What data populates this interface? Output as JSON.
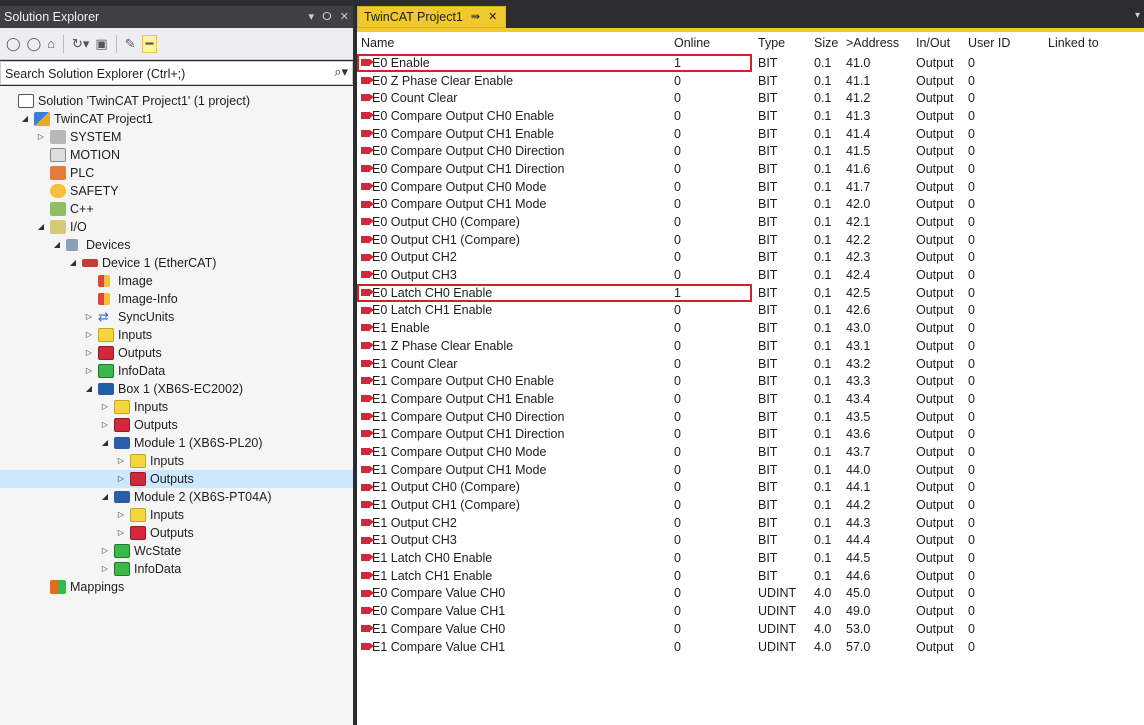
{
  "solution_explorer": {
    "title": "Solution Explorer",
    "title_controls": [
      "▾",
      "ⵔ",
      "✕"
    ],
    "toolbar_icons": [
      "back-icon",
      "forward-icon",
      "home-icon",
      "history-icon",
      "sync-icon",
      "collapse-all-icon",
      "properties-icon",
      "pin-icon"
    ],
    "search_placeholder": "Search Solution Explorer (Ctrl+;)",
    "tree": [
      {
        "label": "Solution 'TwinCAT Project1' (1 project)",
        "icon": "solution-icon",
        "level": 0,
        "expander": ""
      },
      {
        "label": "TwinCAT Project1",
        "icon": "project-icon",
        "level": 1,
        "expander": "◢"
      },
      {
        "label": "SYSTEM",
        "icon": "system-icon",
        "level": 2,
        "expander": "▷"
      },
      {
        "label": "MOTION",
        "icon": "motion-icon",
        "level": 2,
        "expander": ""
      },
      {
        "label": "PLC",
        "icon": "plc-icon",
        "level": 2,
        "expander": ""
      },
      {
        "label": "SAFETY",
        "icon": "safety-icon",
        "level": 2,
        "expander": ""
      },
      {
        "label": "C++",
        "icon": "cpp-icon",
        "level": 2,
        "expander": ""
      },
      {
        "label": "I/O",
        "icon": "io-icon",
        "level": 2,
        "expander": "◢"
      },
      {
        "label": "Devices",
        "icon": "devices-icon",
        "level": 3,
        "expander": "◢"
      },
      {
        "label": "Device 1 (EtherCAT)",
        "icon": "ethercat-device-icon",
        "level": 4,
        "expander": "◢"
      },
      {
        "label": "Image",
        "icon": "image-icon",
        "level": 5,
        "expander": ""
      },
      {
        "label": "Image-Info",
        "icon": "image-info-icon",
        "level": 5,
        "expander": ""
      },
      {
        "label": "SyncUnits",
        "icon": "sync-units-icon",
        "level": 5,
        "expander": "▷"
      },
      {
        "label": "Inputs",
        "icon": "inputs-icon",
        "level": 5,
        "expander": "▷"
      },
      {
        "label": "Outputs",
        "icon": "outputs-icon",
        "level": 5,
        "expander": "▷"
      },
      {
        "label": "InfoData",
        "icon": "infodata-icon",
        "level": 5,
        "expander": "▷"
      },
      {
        "label": "Box 1 (XB6S-EC2002)",
        "icon": "box-icon",
        "level": 5,
        "expander": "◢"
      },
      {
        "label": "Inputs",
        "icon": "inputs-icon",
        "level": 6,
        "expander": "▷"
      },
      {
        "label": "Outputs",
        "icon": "outputs-icon",
        "level": 6,
        "expander": "▷"
      },
      {
        "label": "Module 1 (XB6S-PL20)",
        "icon": "module-icon",
        "level": 6,
        "expander": "◢"
      },
      {
        "label": "Inputs",
        "icon": "inputs-icon",
        "level": 7,
        "expander": "▷"
      },
      {
        "label": "Outputs",
        "icon": "outputs-icon",
        "level": 7,
        "expander": "▷",
        "selected": true
      },
      {
        "label": "Module 2 (XB6S-PT04A)",
        "icon": "module-icon",
        "level": 6,
        "expander": "◢"
      },
      {
        "label": "Inputs",
        "icon": "inputs-icon",
        "level": 7,
        "expander": "▷"
      },
      {
        "label": "Outputs",
        "icon": "outputs-icon",
        "level": 7,
        "expander": "▷"
      },
      {
        "label": "WcState",
        "icon": "wcstate-icon",
        "level": 6,
        "expander": "▷"
      },
      {
        "label": "InfoData",
        "icon": "infodata-icon",
        "level": 6,
        "expander": "▷"
      },
      {
        "label": "Mappings",
        "icon": "mappings-icon",
        "level": 2,
        "expander": ""
      }
    ]
  },
  "editor": {
    "tab": {
      "label": "TwinCAT Project1",
      "pin": "⇛",
      "close": "✕"
    },
    "columns": [
      "Name",
      "Online",
      "Type",
      "Size",
      ">Address",
      "In/Out",
      "User ID",
      "Linked to"
    ],
    "rows": [
      {
        "name": "E0 Enable",
        "online": "1",
        "type": "BIT",
        "size": "0.1",
        "address": "41.0",
        "inout": "Output",
        "userid": "0",
        "linked": "",
        "highlighted": true
      },
      {
        "name": "E0 Z Phase Clear Enable",
        "online": "0",
        "type": "BIT",
        "size": "0.1",
        "address": "41.1",
        "inout": "Output",
        "userid": "0",
        "linked": ""
      },
      {
        "name": "E0 Count Clear",
        "online": "0",
        "type": "BIT",
        "size": "0.1",
        "address": "41.2",
        "inout": "Output",
        "userid": "0",
        "linked": ""
      },
      {
        "name": "E0 Compare Output CH0 Enable",
        "online": "0",
        "type": "BIT",
        "size": "0.1",
        "address": "41.3",
        "inout": "Output",
        "userid": "0",
        "linked": ""
      },
      {
        "name": "E0 Compare Output CH1 Enable",
        "online": "0",
        "type": "BIT",
        "size": "0.1",
        "address": "41.4",
        "inout": "Output",
        "userid": "0",
        "linked": ""
      },
      {
        "name": "E0 Compare Output CH0 Direction",
        "online": "0",
        "type": "BIT",
        "size": "0.1",
        "address": "41.5",
        "inout": "Output",
        "userid": "0",
        "linked": ""
      },
      {
        "name": "E0 Compare Output CH1 Direction",
        "online": "0",
        "type": "BIT",
        "size": "0.1",
        "address": "41.6",
        "inout": "Output",
        "userid": "0",
        "linked": ""
      },
      {
        "name": "E0 Compare Output CH0 Mode",
        "online": "0",
        "type": "BIT",
        "size": "0.1",
        "address": "41.7",
        "inout": "Output",
        "userid": "0",
        "linked": ""
      },
      {
        "name": "E0 Compare Output CH1 Mode",
        "online": "0",
        "type": "BIT",
        "size": "0.1",
        "address": "42.0",
        "inout": "Output",
        "userid": "0",
        "linked": ""
      },
      {
        "name": "E0 Output CH0 (Compare)",
        "online": "0",
        "type": "BIT",
        "size": "0.1",
        "address": "42.1",
        "inout": "Output",
        "userid": "0",
        "linked": ""
      },
      {
        "name": "E0 Output CH1 (Compare)",
        "online": "0",
        "type": "BIT",
        "size": "0.1",
        "address": "42.2",
        "inout": "Output",
        "userid": "0",
        "linked": ""
      },
      {
        "name": "E0 Output CH2",
        "online": "0",
        "type": "BIT",
        "size": "0.1",
        "address": "42.3",
        "inout": "Output",
        "userid": "0",
        "linked": ""
      },
      {
        "name": "E0 Output CH3",
        "online": "0",
        "type": "BIT",
        "size": "0.1",
        "address": "42.4",
        "inout": "Output",
        "userid": "0",
        "linked": ""
      },
      {
        "name": "E0 Latch CH0 Enable",
        "online": "1",
        "type": "BIT",
        "size": "0.1",
        "address": "42.5",
        "inout": "Output",
        "userid": "0",
        "linked": "",
        "highlighted": true
      },
      {
        "name": "E0 Latch CH1 Enable",
        "online": "0",
        "type": "BIT",
        "size": "0.1",
        "address": "42.6",
        "inout": "Output",
        "userid": "0",
        "linked": ""
      },
      {
        "name": "E1 Enable",
        "online": "0",
        "type": "BIT",
        "size": "0.1",
        "address": "43.0",
        "inout": "Output",
        "userid": "0",
        "linked": ""
      },
      {
        "name": "E1 Z Phase Clear Enable",
        "online": "0",
        "type": "BIT",
        "size": "0.1",
        "address": "43.1",
        "inout": "Output",
        "userid": "0",
        "linked": ""
      },
      {
        "name": "E1 Count Clear",
        "online": "0",
        "type": "BIT",
        "size": "0.1",
        "address": "43.2",
        "inout": "Output",
        "userid": "0",
        "linked": ""
      },
      {
        "name": "E1 Compare Output CH0 Enable",
        "online": "0",
        "type": "BIT",
        "size": "0.1",
        "address": "43.3",
        "inout": "Output",
        "userid": "0",
        "linked": ""
      },
      {
        "name": "E1 Compare Output CH1 Enable",
        "online": "0",
        "type": "BIT",
        "size": "0.1",
        "address": "43.4",
        "inout": "Output",
        "userid": "0",
        "linked": ""
      },
      {
        "name": "E1 Compare Output CH0 Direction",
        "online": "0",
        "type": "BIT",
        "size": "0.1",
        "address": "43.5",
        "inout": "Output",
        "userid": "0",
        "linked": ""
      },
      {
        "name": "E1 Compare Output CH1 Direction",
        "online": "0",
        "type": "BIT",
        "size": "0.1",
        "address": "43.6",
        "inout": "Output",
        "userid": "0",
        "linked": ""
      },
      {
        "name": "E1 Compare Output CH0 Mode",
        "online": "0",
        "type": "BIT",
        "size": "0.1",
        "address": "43.7",
        "inout": "Output",
        "userid": "0",
        "linked": ""
      },
      {
        "name": "E1 Compare Output CH1 Mode",
        "online": "0",
        "type": "BIT",
        "size": "0.1",
        "address": "44.0",
        "inout": "Output",
        "userid": "0",
        "linked": ""
      },
      {
        "name": "E1 Output CH0 (Compare)",
        "online": "0",
        "type": "BIT",
        "size": "0.1",
        "address": "44.1",
        "inout": "Output",
        "userid": "0",
        "linked": ""
      },
      {
        "name": "E1 Output CH1 (Compare)",
        "online": "0",
        "type": "BIT",
        "size": "0.1",
        "address": "44.2",
        "inout": "Output",
        "userid": "0",
        "linked": ""
      },
      {
        "name": "E1 Output CH2",
        "online": "0",
        "type": "BIT",
        "size": "0.1",
        "address": "44.3",
        "inout": "Output",
        "userid": "0",
        "linked": ""
      },
      {
        "name": "E1 Output CH3",
        "online": "0",
        "type": "BIT",
        "size": "0.1",
        "address": "44.4",
        "inout": "Output",
        "userid": "0",
        "linked": ""
      },
      {
        "name": "E1 Latch CH0 Enable",
        "online": "0",
        "type": "BIT",
        "size": "0.1",
        "address": "44.5",
        "inout": "Output",
        "userid": "0",
        "linked": ""
      },
      {
        "name": "E1 Latch CH1 Enable",
        "online": "0",
        "type": "BIT",
        "size": "0.1",
        "address": "44.6",
        "inout": "Output",
        "userid": "0",
        "linked": ""
      },
      {
        "name": "E0 Compare Value CH0",
        "online": "0",
        "type": "UDINT",
        "size": "4.0",
        "address": "45.0",
        "inout": "Output",
        "userid": "0",
        "linked": ""
      },
      {
        "name": "E0 Compare Value CH1",
        "online": "0",
        "type": "UDINT",
        "size": "4.0",
        "address": "49.0",
        "inout": "Output",
        "userid": "0",
        "linked": ""
      },
      {
        "name": "E1 Compare Value CH0",
        "online": "0",
        "type": "UDINT",
        "size": "4.0",
        "address": "53.0",
        "inout": "Output",
        "userid": "0",
        "linked": ""
      },
      {
        "name": "E1 Compare Value CH1",
        "online": "0",
        "type": "UDINT",
        "size": "4.0",
        "address": "57.0",
        "inout": "Output",
        "userid": "0",
        "linked": ""
      }
    ]
  },
  "colors": {
    "title_bar": "#3f3f46",
    "tab_active": "#f0c92e",
    "highlight_border": "#d0222a",
    "selection": "#cce8ff"
  }
}
